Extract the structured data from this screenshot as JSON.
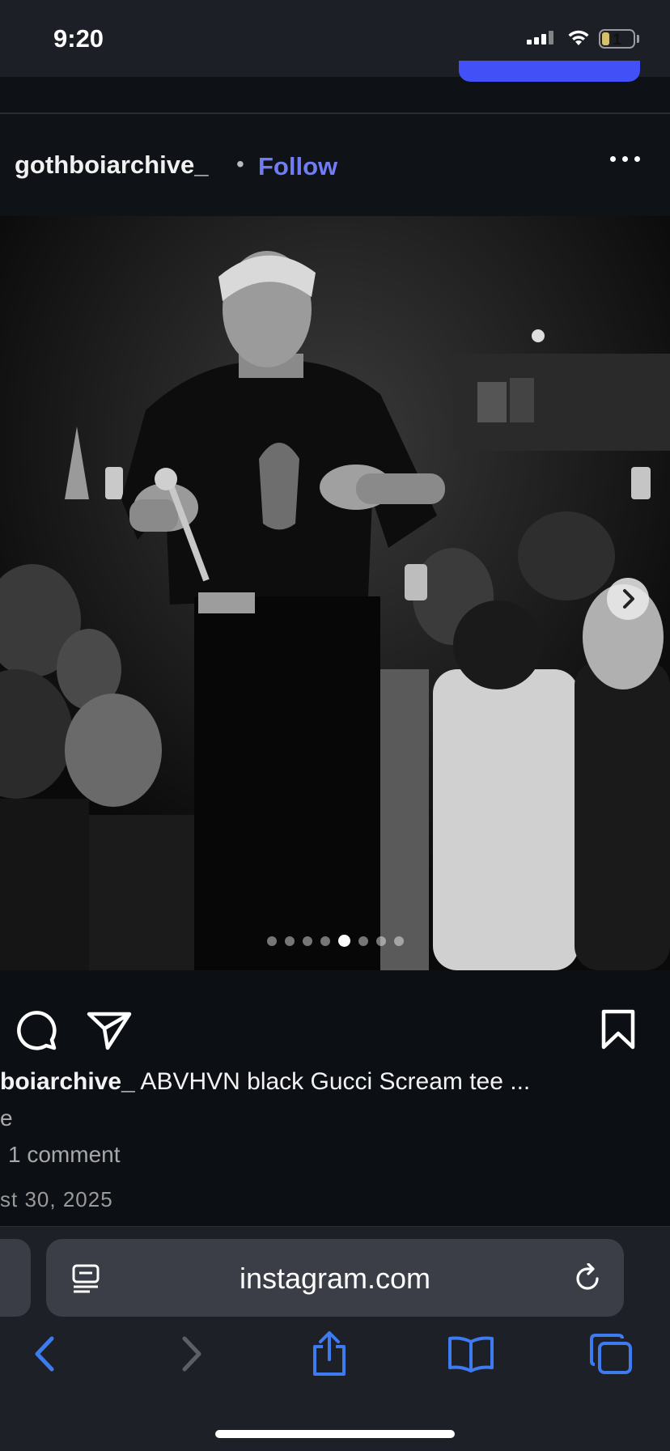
{
  "status_bar": {
    "time": "9:20",
    "battery_level": "1"
  },
  "post": {
    "username": "gothboiarchive_",
    "separator": "•",
    "follow_label": "Follow",
    "carousel": {
      "total_slides": 8,
      "active_index": 4
    },
    "caption": {
      "username_fragment": "boiarchive_",
      "text": " ABVHVN black Gucci Scream tee ...",
      "second_line": "e"
    },
    "comments_label": "1 comment",
    "date_fragment": "st 30, 2025"
  },
  "browser": {
    "url": "instagram.com"
  },
  "colors": {
    "accent": "#6f7cf5",
    "browser_blue": "#3f7bf0",
    "background": "#0c0f14"
  }
}
